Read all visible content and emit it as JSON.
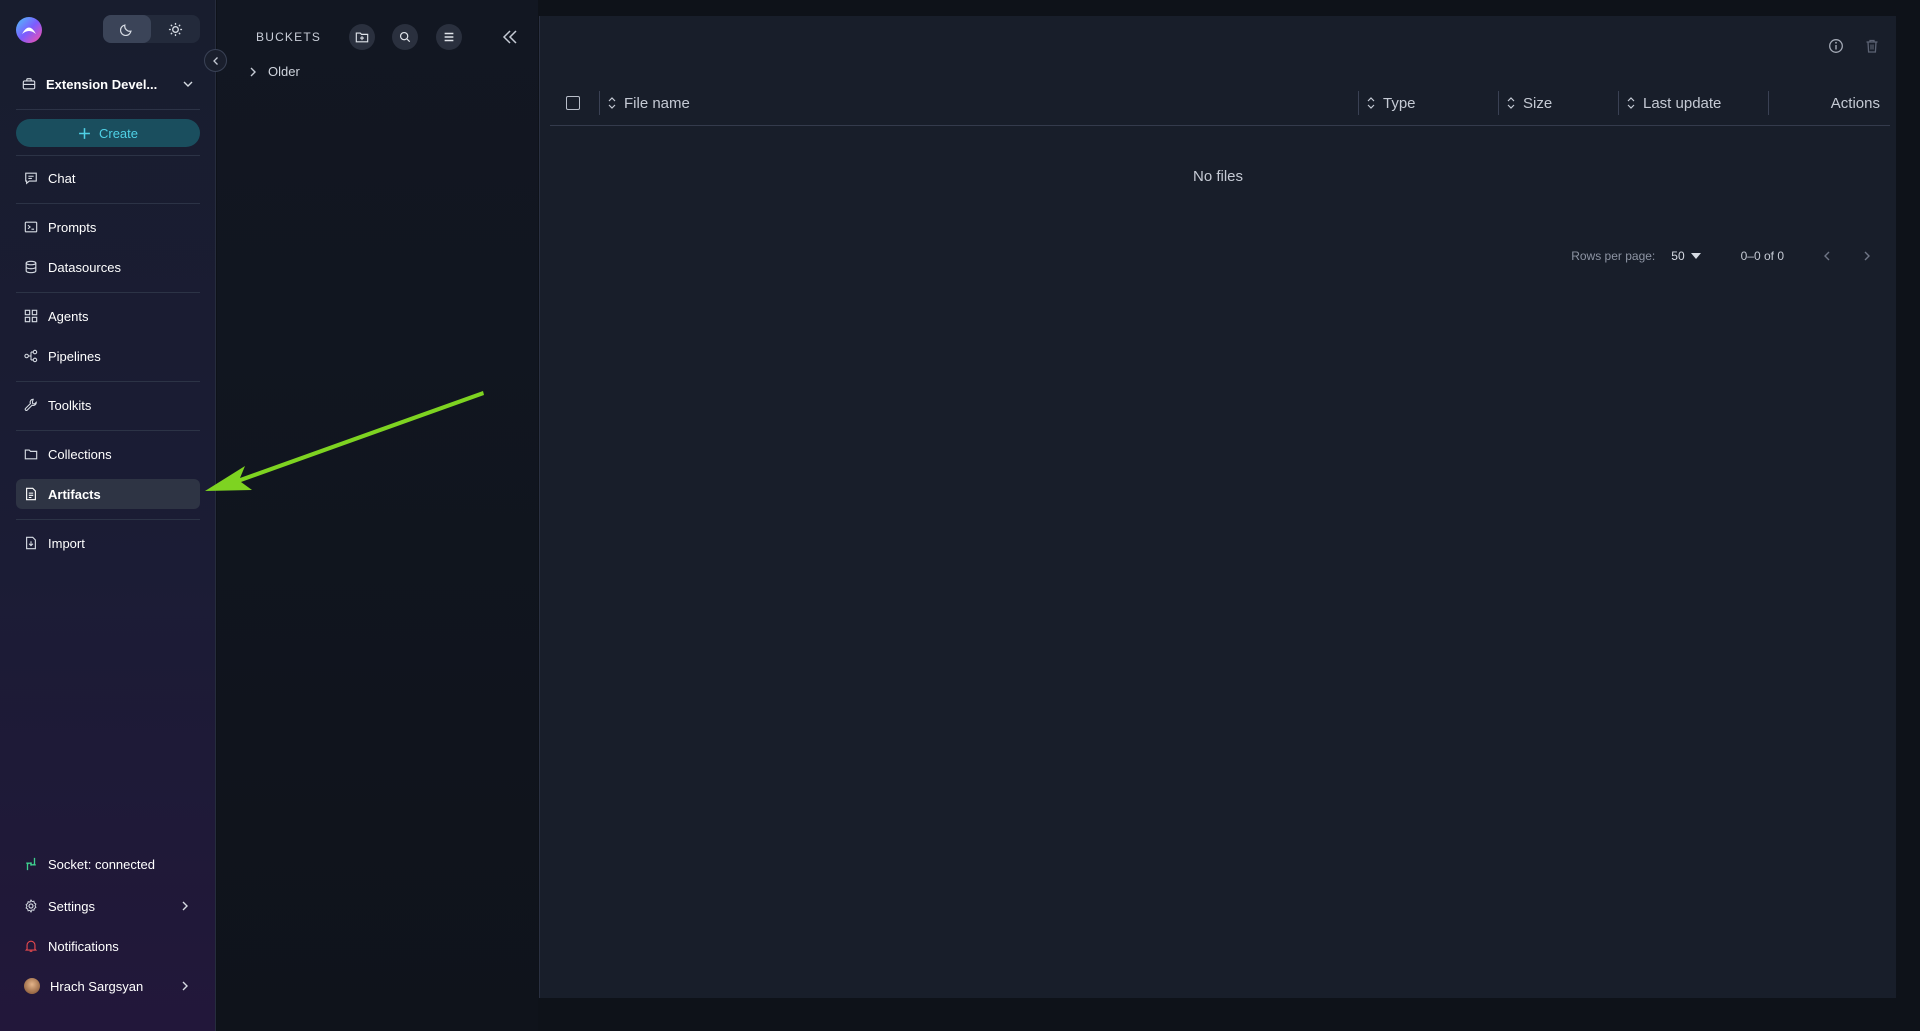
{
  "sidebar": {
    "project_name": "Extension Devel...",
    "create_label": "Create",
    "nav": {
      "chat": "Chat",
      "prompts": "Prompts",
      "datasources": "Datasources",
      "agents": "Agents",
      "pipelines": "Pipelines",
      "toolkits": "Toolkits",
      "collections": "Collections",
      "artifacts": "Artifacts",
      "import": "Import"
    },
    "socket_status": "Socket: connected",
    "settings": "Settings",
    "notifications": "Notifications",
    "user_name": "Hrach Sargsyan",
    "active_item": "Artifacts"
  },
  "buckets": {
    "title": "BUCKETS",
    "items": [
      {
        "label": "Older"
      }
    ]
  },
  "table": {
    "columns": {
      "file_name": "File name",
      "type": "Type",
      "size": "Size",
      "last_update": "Last update",
      "actions": "Actions"
    },
    "empty_message": "No files"
  },
  "pagination": {
    "rows_per_page_label": "Rows per page:",
    "rows_per_page_value": "50",
    "range": "0–0 of 0"
  },
  "colors": {
    "accent": "#4fd1e6",
    "annotation_arrow": "#7ed321",
    "socket_connected": "#3ecf8e",
    "notification": "#e5484d"
  },
  "icons": {
    "logo": "app-logo",
    "dark_mode": "moon-icon",
    "light_mode": "sun-icon",
    "project": "briefcase-icon",
    "info": "info-icon",
    "delete": "trash-icon"
  }
}
